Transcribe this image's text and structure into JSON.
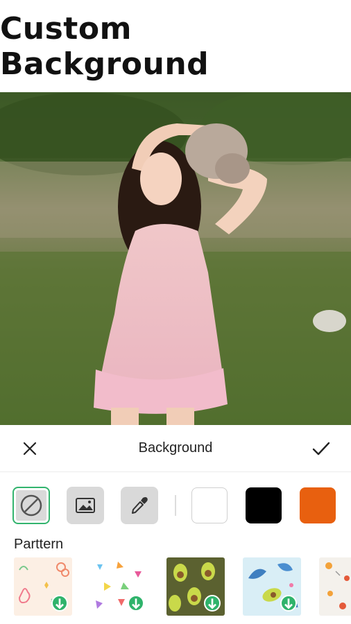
{
  "promo": {
    "headline": "Custom Background"
  },
  "photo": {
    "alt": "portrait"
  },
  "toolbar": {
    "title": "Background",
    "close_icon": "close-icon",
    "confirm_icon": "check-icon"
  },
  "colors": {
    "tools": [
      "none-icon",
      "image-icon",
      "eyedropper-icon"
    ],
    "swatches": [
      "#ffffff",
      "#000000",
      "#e8600f"
    ],
    "accent": "#32b46e"
  },
  "patterns": {
    "label": "Parttern",
    "items": [
      "pattern-doodle",
      "pattern-triangles",
      "pattern-avocado",
      "pattern-leaves",
      "pattern-flowers"
    ]
  }
}
